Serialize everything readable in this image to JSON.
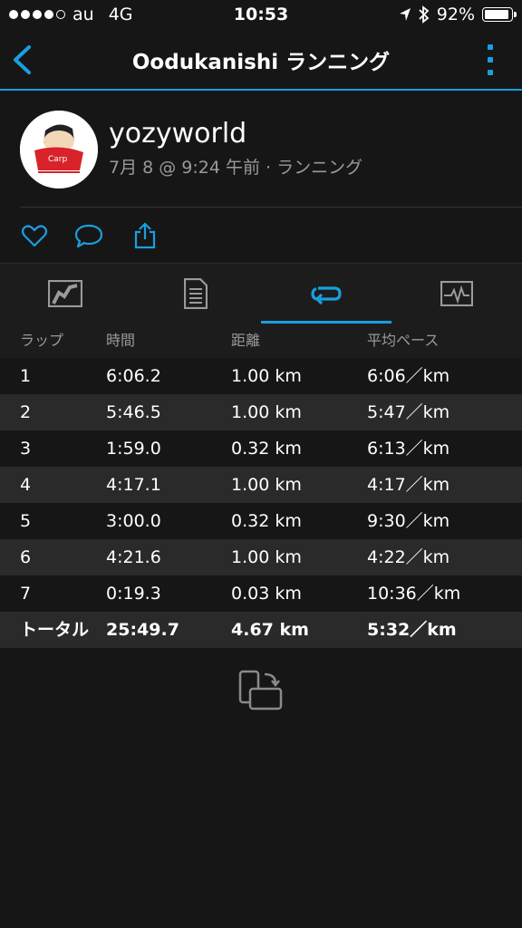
{
  "status_bar": {
    "carrier": "au",
    "network": "4G",
    "time": "10:53",
    "battery": "92%"
  },
  "nav": {
    "title": "Oodukanishi ランニング"
  },
  "profile": {
    "username": "yozyworld",
    "meta": "7月 8 @ 9:24 午前 · ランニング"
  },
  "table": {
    "headers": [
      "ラップ",
      "時間",
      "距離",
      "平均ペース"
    ],
    "rows": [
      [
        "1",
        "6:06.2",
        "1.00 km",
        "6:06／km"
      ],
      [
        "2",
        "5:46.5",
        "1.00 km",
        "5:47／km"
      ],
      [
        "3",
        "1:59.0",
        "0.32 km",
        "6:13／km"
      ],
      [
        "4",
        "4:17.1",
        "1.00 km",
        "4:17／km"
      ],
      [
        "5",
        "3:00.0",
        "0.32 km",
        "9:30／km"
      ],
      [
        "6",
        "4:21.6",
        "1.00 km",
        "4:22／km"
      ],
      [
        "7",
        "0:19.3",
        "0.03 km",
        "10:36／km"
      ]
    ],
    "total": [
      "トータル",
      "25:49.7",
      "4.67 km",
      "5:32／km"
    ]
  },
  "colors": {
    "accent": "#1a9ee0",
    "background": "#161616",
    "row_alt": "#2a2a2a"
  }
}
